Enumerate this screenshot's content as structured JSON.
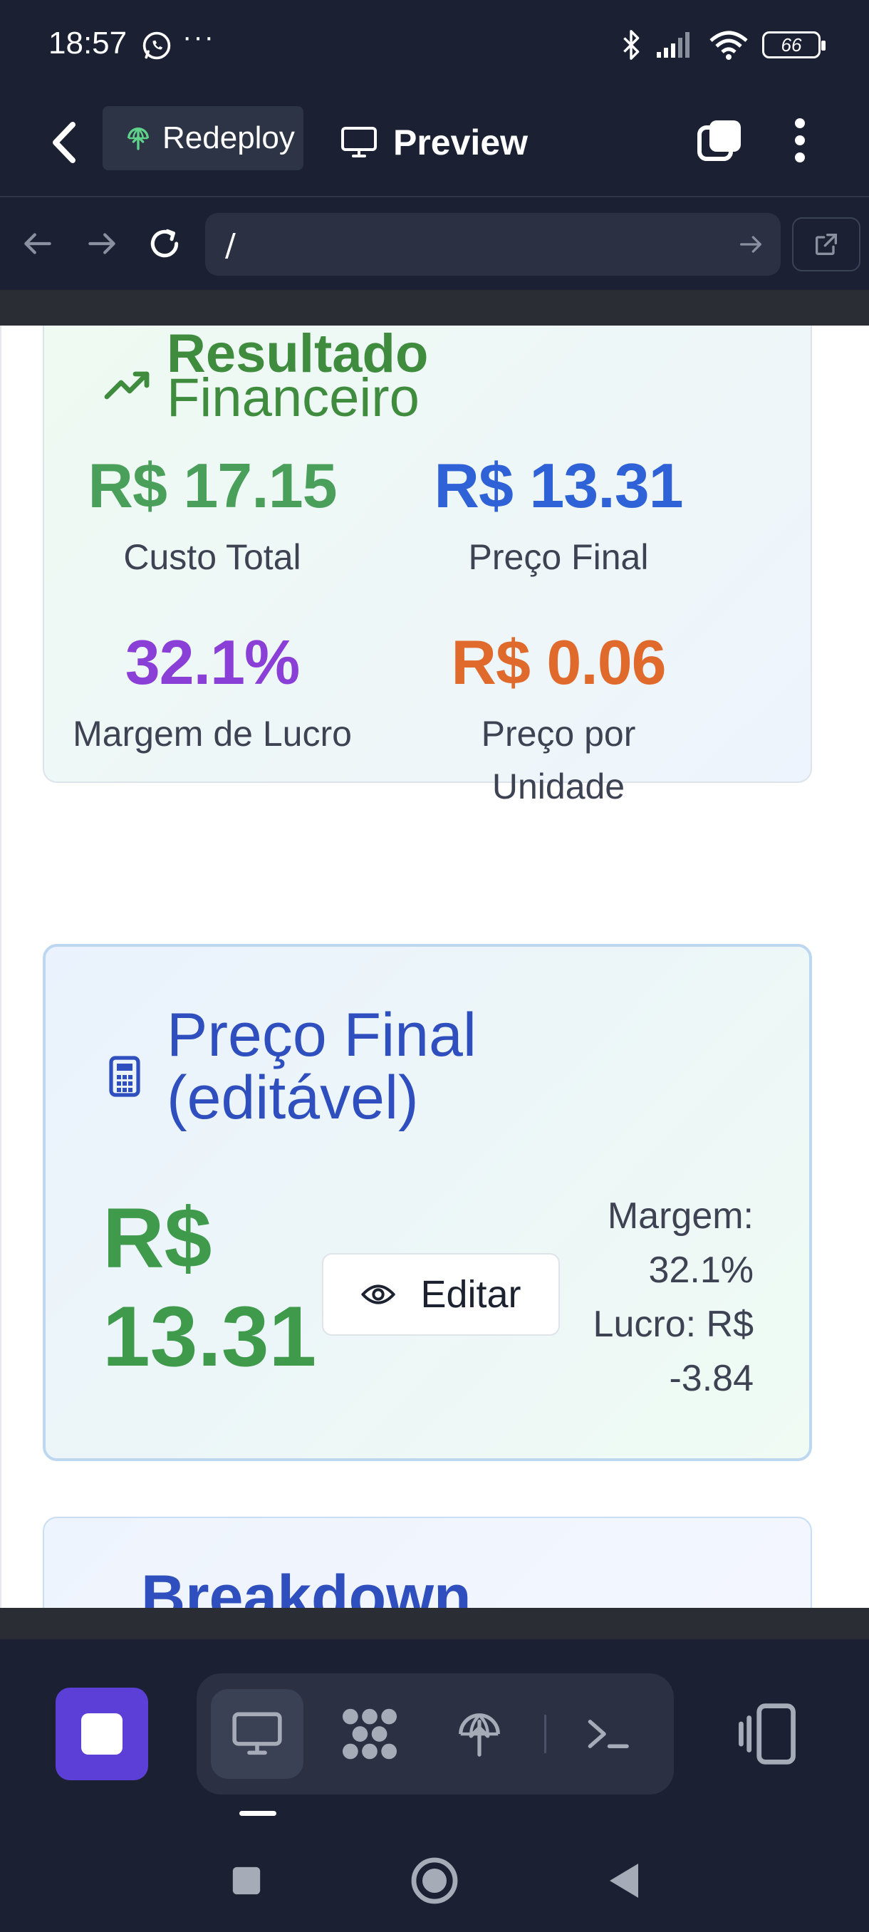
{
  "status_bar": {
    "time": "18:57",
    "more": "···",
    "battery": "66"
  },
  "app_bar": {
    "project_label": "Redeploy",
    "view_label": "Preview"
  },
  "url_bar": {
    "path": "/"
  },
  "result_card": {
    "title_partial": "Resultado",
    "title": "Financeiro",
    "metrics": [
      {
        "value": "R$ 17.15",
        "label": "Custo Total",
        "color": "#4aa05a"
      },
      {
        "value": "R$ 13.31",
        "label": "Preço Final",
        "color": "#2f62d6"
      },
      {
        "value": "32.1%",
        "label": "Margem de Lucro",
        "color": "#8a3fd6"
      },
      {
        "value": "R$ 0.06",
        "label_line1": "Preço por",
        "label_line2": "Unidade",
        "color": "#e06a2c"
      }
    ]
  },
  "price_card": {
    "title_line1": "Preço Final",
    "title_line2": "(editável)",
    "price_line1": "R$",
    "price_line2": "13.31",
    "edit_label": "Editar",
    "margin_line1": "Margem:",
    "margin_line2": "32.1%",
    "profit_line1": "Lucro: R$",
    "profit_line2": "-3.84"
  },
  "breakdown_card": {
    "title": "Breakdown"
  },
  "colors": {
    "accent": "#5b3fd6",
    "background": "#1b2132",
    "green": "#3f9a4c",
    "blue_title": "#2f4fbf"
  },
  "icons": {
    "back": "arrow-left-icon",
    "project": "globe-upload-icon",
    "preview": "monitor-icon",
    "tabs": "tabs-icon",
    "menu": "more-vertical-icon",
    "nav_back": "arrow-left-icon",
    "nav_forward": "arrow-right-icon",
    "reload": "reload-icon",
    "go": "arrow-right-icon",
    "external": "external-link-icon",
    "trend": "trending-up-icon",
    "calculator": "calculator-icon",
    "eye": "eye-icon",
    "stop": "stop-icon",
    "desktop": "monitor-icon",
    "integrations": "nodes-icon",
    "deploy": "globe-upload-icon",
    "terminal": "terminal-icon",
    "devices": "devices-icon"
  }
}
